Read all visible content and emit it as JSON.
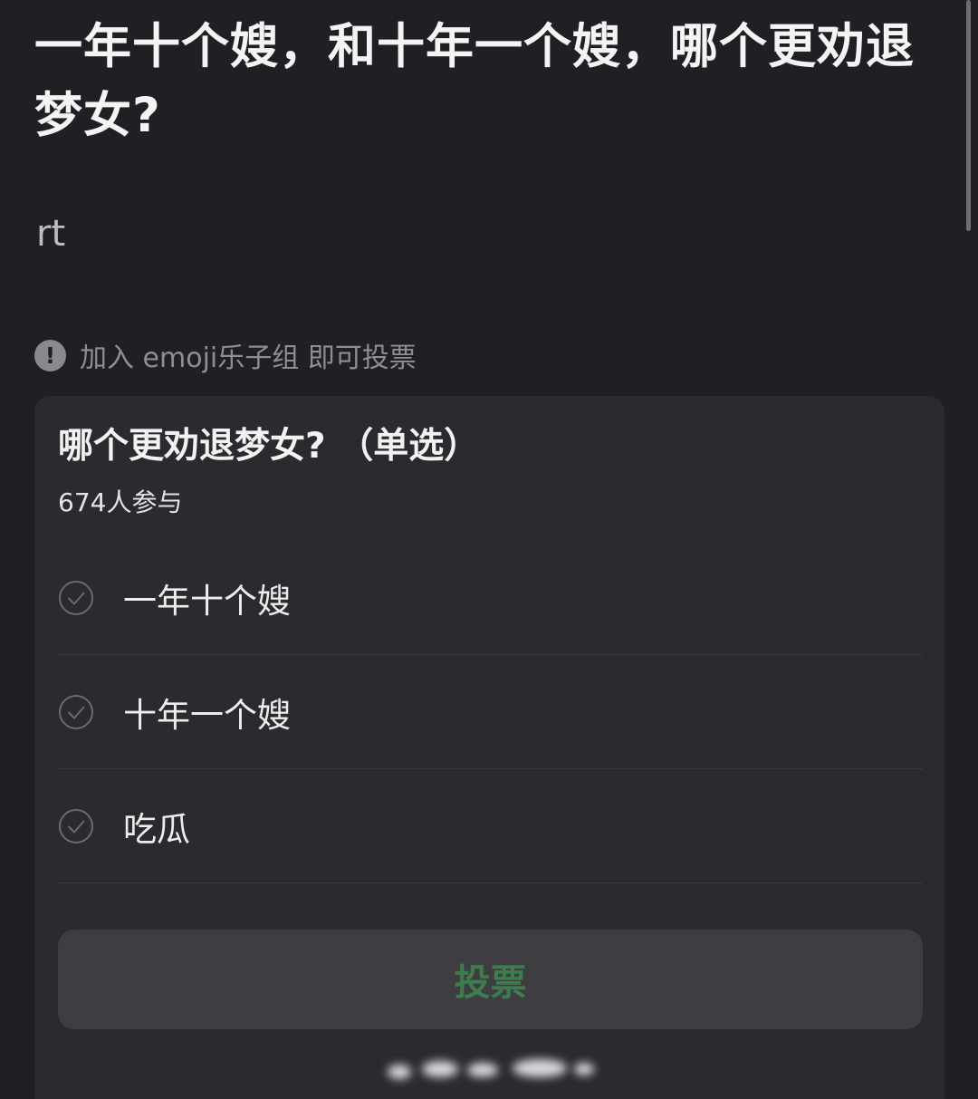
{
  "post": {
    "title": "一年十个嫂，和十年一个嫂，哪个更劝退梦女?",
    "body": "rt"
  },
  "notice": {
    "icon": "exclamation-circle-icon",
    "text": "加入 emoji乐子组 即可投票"
  },
  "poll": {
    "title": "哪个更劝退梦女? （单选）",
    "participants": "674人参与",
    "options": [
      {
        "label": "一年十个嫂",
        "icon": "check-circle-icon"
      },
      {
        "label": "十年一个嫂",
        "icon": "check-circle-icon"
      },
      {
        "label": "吃瓜",
        "icon": "check-circle-icon"
      }
    ],
    "vote_label": "投票"
  },
  "colors": {
    "background": "#202024",
    "card": "#2b2b2f",
    "button": "#3d3d42",
    "vote_text": "#3d7d4d",
    "muted": "#8e8e93"
  }
}
